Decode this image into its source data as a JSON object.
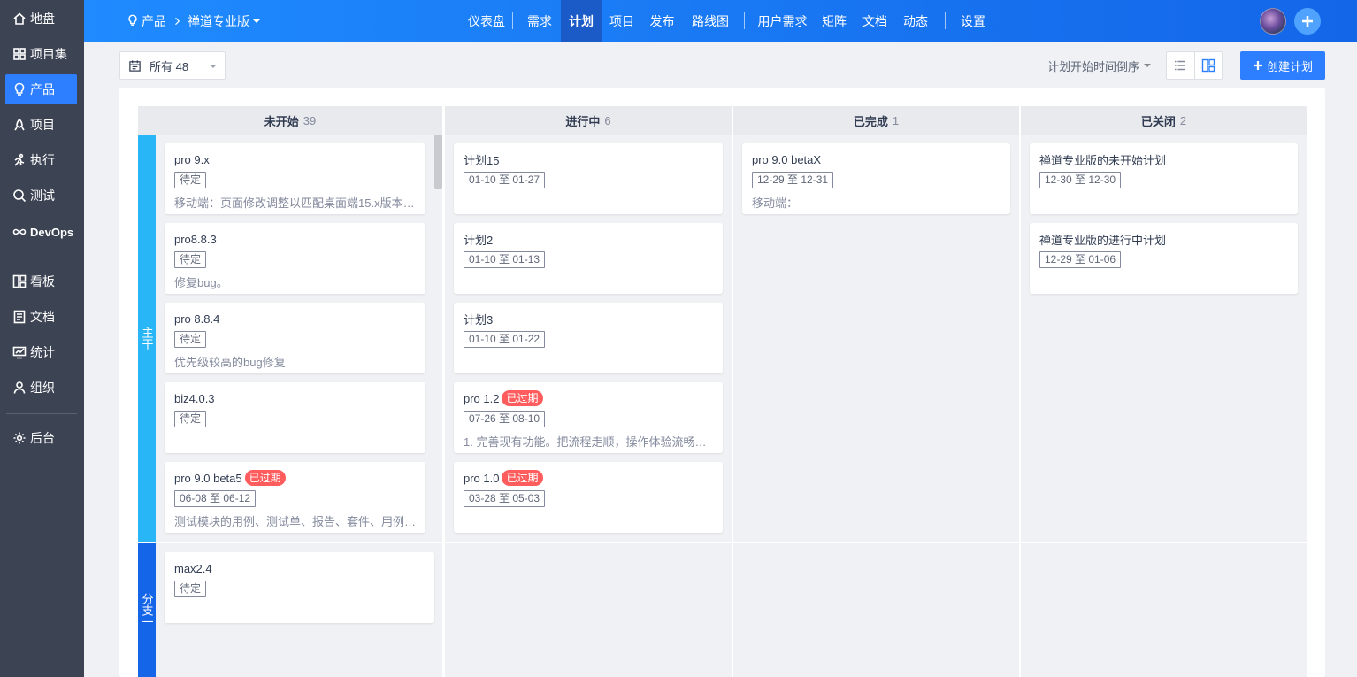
{
  "sidebar": {
    "items": [
      {
        "label": "地盘",
        "icon": "home-icon"
      },
      {
        "label": "项目集",
        "icon": "grid-icon"
      },
      {
        "label": "产品",
        "icon": "bulb-icon",
        "active": true
      },
      {
        "label": "项目",
        "icon": "project-icon"
      },
      {
        "label": "执行",
        "icon": "run-icon"
      },
      {
        "label": "测试",
        "icon": "test-icon"
      },
      {
        "label": "DevOps",
        "icon": "infinity-icon"
      },
      {
        "label": "看板",
        "icon": "kanban-icon"
      },
      {
        "label": "文档",
        "icon": "doc-icon"
      },
      {
        "label": "统计",
        "icon": "chart-icon"
      },
      {
        "label": "组织",
        "icon": "user-icon"
      },
      {
        "label": "后台",
        "icon": "gear-icon"
      }
    ]
  },
  "header": {
    "breadcrumb": {
      "root": "产品",
      "current": "禅道专业版"
    },
    "menu": [
      "仪表盘",
      "需求",
      "计划",
      "项目",
      "发布",
      "路线图",
      "用户需求",
      "矩阵",
      "文档",
      "动态",
      "设置"
    ],
    "active_menu": "计划"
  },
  "toolbar": {
    "filter_label": "所有 48",
    "sort_label": "计划开始时间倒序",
    "create_label": "创建计划"
  },
  "board": {
    "columns": [
      {
        "title": "未开始",
        "count": "39"
      },
      {
        "title": "进行中",
        "count": "6"
      },
      {
        "title": "已完成",
        "count": "1"
      },
      {
        "title": "已关闭",
        "count": "2"
      }
    ],
    "lanes": [
      {
        "label": "主干",
        "cells": [
          [
            {
              "title": "pro 9.x",
              "tag": "待定",
              "desc": "移动端：页面修改调整以匹配桌面端15.x版本…"
            },
            {
              "title": "pro8.8.3",
              "tag": "待定",
              "desc": "修复bug。"
            },
            {
              "title": "pro 8.8.4",
              "tag": "待定",
              "desc": "优先级较高的bug修复"
            },
            {
              "title": "biz4.0.3",
              "tag": "待定",
              "desc": ""
            },
            {
              "title": "pro 9.0 beta5",
              "expired": "已过期",
              "tag": "06-08 至 06-12",
              "desc": "测试模块的用例、测试单、报告、套件、用例…"
            }
          ],
          [
            {
              "title": "计划15",
              "tag": "01-10 至 01-27",
              "desc": ""
            },
            {
              "title": "计划2",
              "tag": "01-10 至 01-13",
              "desc": ""
            },
            {
              "title": "计划3",
              "tag": "01-10 至 01-22",
              "desc": ""
            },
            {
              "title": "pro 1.2",
              "expired": "已过期",
              "tag": "07-26 至 08-10",
              "desc": "1. 完善现有功能。把流程走顺，操作体验流畅…"
            },
            {
              "title": "pro 1.0",
              "expired": "已过期",
              "tag": "03-28 至 05-03",
              "desc": ""
            }
          ],
          [
            {
              "title": "pro 9.0 betaX",
              "tag": "12-29 至 12-31",
              "desc": "移动端："
            }
          ],
          [
            {
              "title": "禅道专业版的未开始计划",
              "tag": "12-30 至 12-30",
              "desc": ""
            },
            {
              "title": "禅道专业版的进行中计划",
              "tag": "12-29 至 01-06",
              "desc": ""
            }
          ]
        ]
      },
      {
        "label": "分支一",
        "cells": [
          [
            {
              "title": "max2.4",
              "tag": "待定",
              "desc": ""
            }
          ],
          [],
          [],
          []
        ]
      }
    ]
  },
  "colors": {
    "sidebar_bg": "#3c4353",
    "accent": "#2e7fff",
    "lane_main": "#29b6f6",
    "lane_branch": "#1565e8",
    "expired": "#ff5d5d"
  }
}
